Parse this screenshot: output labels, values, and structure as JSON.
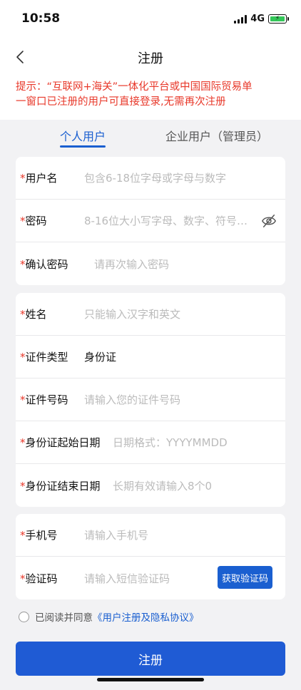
{
  "status": {
    "time": "10:58",
    "network": "4G"
  },
  "nav": {
    "title": "注册"
  },
  "notice": {
    "line1": "提示：“互联网+海关”一体化平台或中国国际贸易单",
    "line2": "一窗口已注册的用户可直接登录,无需再次注册"
  },
  "tabs": {
    "personal": "个人用户",
    "enterprise": "企业用户（管理员）"
  },
  "account": {
    "username": {
      "label": "用户名",
      "placeholder": "包含6-18位字母或字母与数字"
    },
    "password": {
      "label": "密码",
      "placeholder": "8-16位大小写字母、数字、符号…"
    },
    "confirm": {
      "label": "确认密码",
      "placeholder": "请再次输入密码"
    }
  },
  "identity": {
    "name": {
      "label": "姓名",
      "placeholder": "只能输入汉字和英文"
    },
    "id_type": {
      "label": "证件类型",
      "value": "身份证"
    },
    "id_number": {
      "label": "证件号码",
      "placeholder": "请输入您的证件号码"
    },
    "start_date": {
      "label": "身份证起始日期",
      "placeholder": "日期格式：YYYYMMDD"
    },
    "end_date": {
      "label": "身份证结束日期",
      "placeholder": "长期有效请输入8个0"
    }
  },
  "contact": {
    "phone": {
      "label": "手机号",
      "placeholder": "请输入手机号"
    },
    "code": {
      "label": "验证码",
      "placeholder": "请输入短信验证码",
      "button": "获取验证码"
    }
  },
  "agreement": {
    "text": "已阅读并同意",
    "link": "《用户注册及隐私协议》"
  },
  "submit": {
    "label": "注册"
  },
  "colors": {
    "accent": "#1f5bd4",
    "required": "#e8382a",
    "battery": "#34c759"
  }
}
